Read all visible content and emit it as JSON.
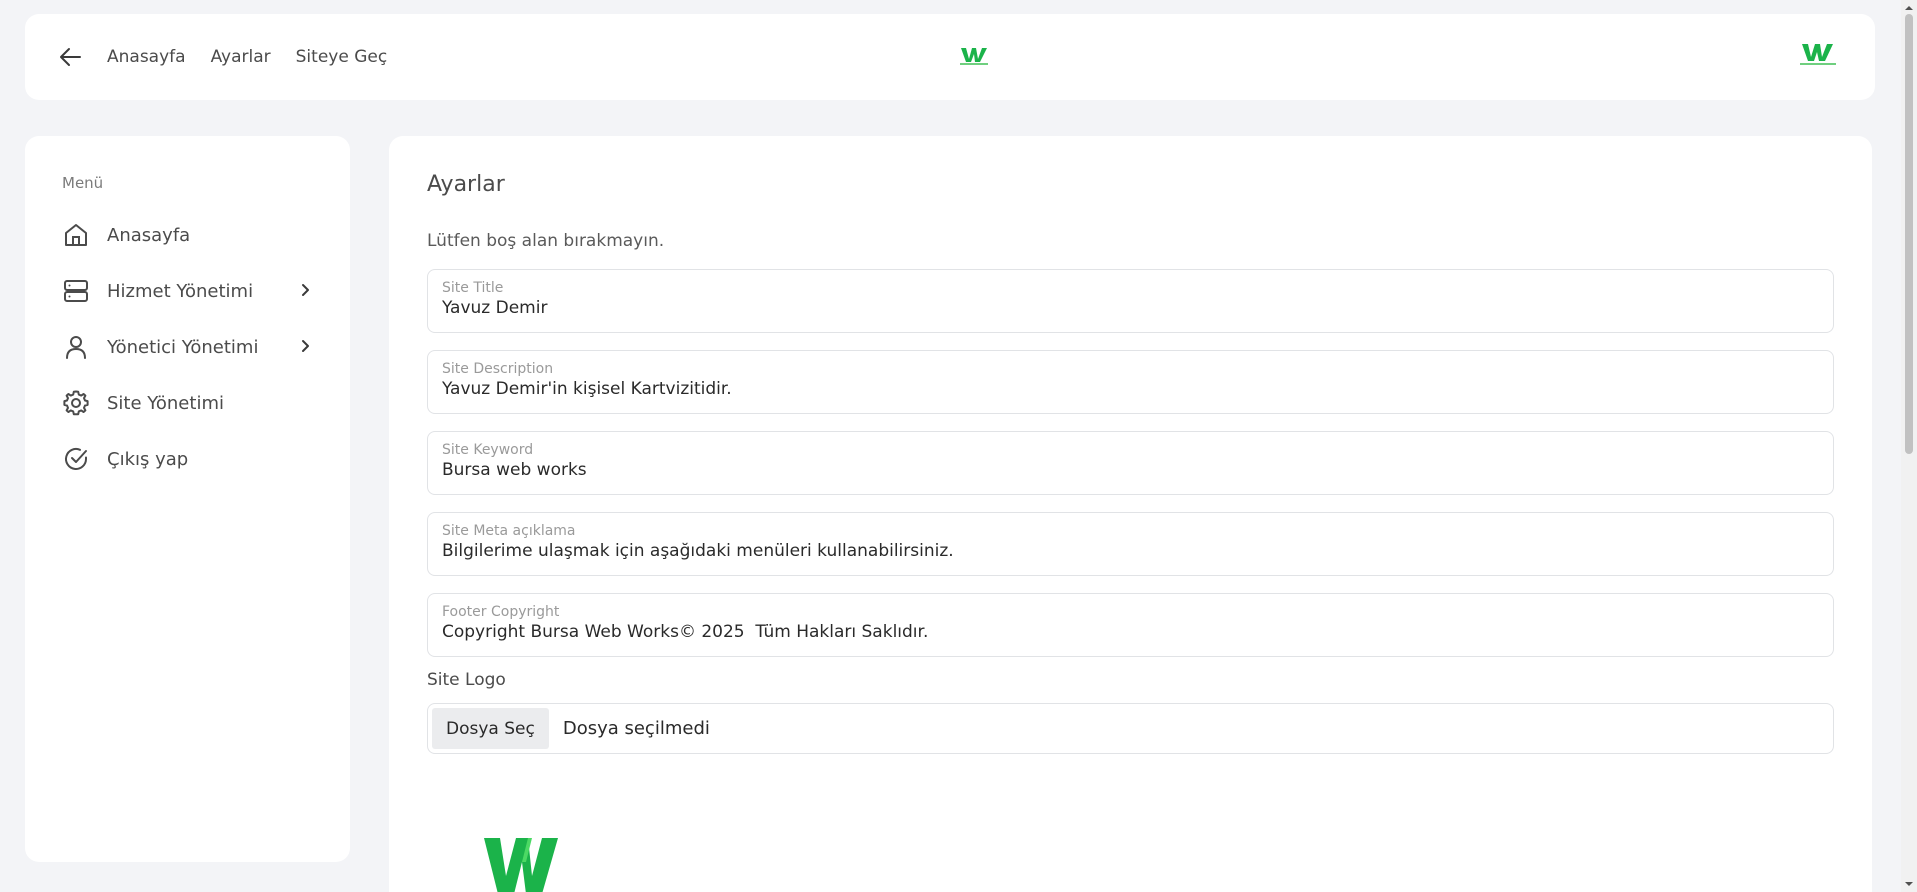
{
  "colors": {
    "brand_green": "#1bb34a",
    "brand_green_light": "#4cd964"
  },
  "header": {
    "back_icon": "arrow-left-icon",
    "links": [
      "Anasayfa",
      "Ayarlar",
      "Siteye Geç"
    ]
  },
  "sidebar": {
    "title": "Menü",
    "items": [
      {
        "label": "Anasayfa",
        "icon": "home-icon",
        "has_submenu": false
      },
      {
        "label": "Hizmet Yönetimi",
        "icon": "server-icon",
        "has_submenu": true
      },
      {
        "label": "Yönetici Yönetimi",
        "icon": "user-icon",
        "has_submenu": true
      },
      {
        "label": "Site Yönetimi",
        "icon": "gear-icon",
        "has_submenu": false
      },
      {
        "label": "Çıkış yap",
        "icon": "check-circle-icon",
        "has_submenu": false
      }
    ]
  },
  "main": {
    "title": "Ayarlar",
    "hint": "Lütfen boş alan bırakmayın.",
    "fields": [
      {
        "label": "Site Title",
        "value": "Yavuz Demir"
      },
      {
        "label": "Site Description",
        "value": "Yavuz Demir'in kişisel Kartvizitidir."
      },
      {
        "label": "Site Keyword",
        "value": "Bursa web works"
      },
      {
        "label": "Site Meta açıklama",
        "value": "Bilgilerime ulaşmak için aşağıdaki menüleri kullanabilirsiniz."
      },
      {
        "label": "Footer Copyright",
        "value": "Copyright Bursa Web Works© 2025  Tüm Hakları Saklıdır."
      }
    ],
    "logo_label": "Site Logo",
    "file_button": "Dosya Seç",
    "file_status": "Dosya seçilmedi"
  }
}
